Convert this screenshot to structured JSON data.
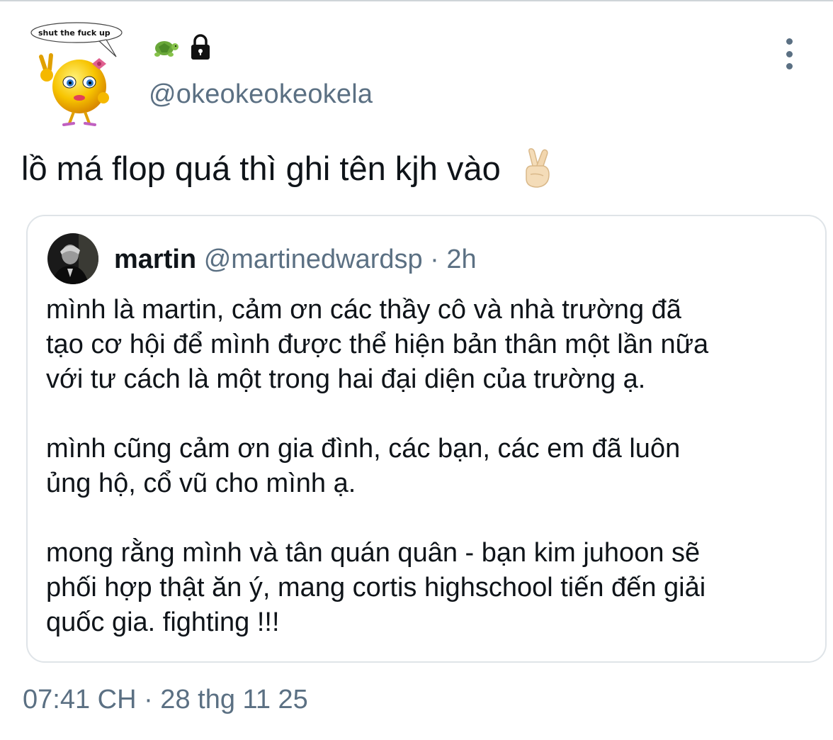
{
  "tweet": {
    "author": {
      "handle": "@okeokeokeokela",
      "avatar_caption": "shut the fuck up",
      "name_icons": [
        "turtle-icon",
        "lock-icon"
      ]
    },
    "text": "lồ má flop quá thì ghi tên kjh vào",
    "text_emoji": "crossed-fingers-icon",
    "timestamp": "07:41 CH · 28 thg 11 25"
  },
  "quote": {
    "name": "martin",
    "meta": "@martinedwardsp · 2h",
    "paragraphs": [
      "mình là martin, cảm ơn các thầy cô và nhà trường đã\ntạo cơ hội để mình được thể hiện bản thân một lần nữa\nvới tư cách là một trong hai đại diện của trường ạ.",
      "mình cũng cảm ơn gia đình, các bạn, các em đã luôn\nủng hộ, cổ vũ cho mình ạ.",
      "mong rằng mình và tân quán quân - bạn kim juhoon sẽ\nphối hợp thật ăn ý, mang cortis highschool tiến đến giải\nquốc gia. fighting !!!"
    ]
  },
  "colors": {
    "text_primary": "#0f1419",
    "text_secondary": "#5b7083",
    "border": "#dfe4e8"
  }
}
